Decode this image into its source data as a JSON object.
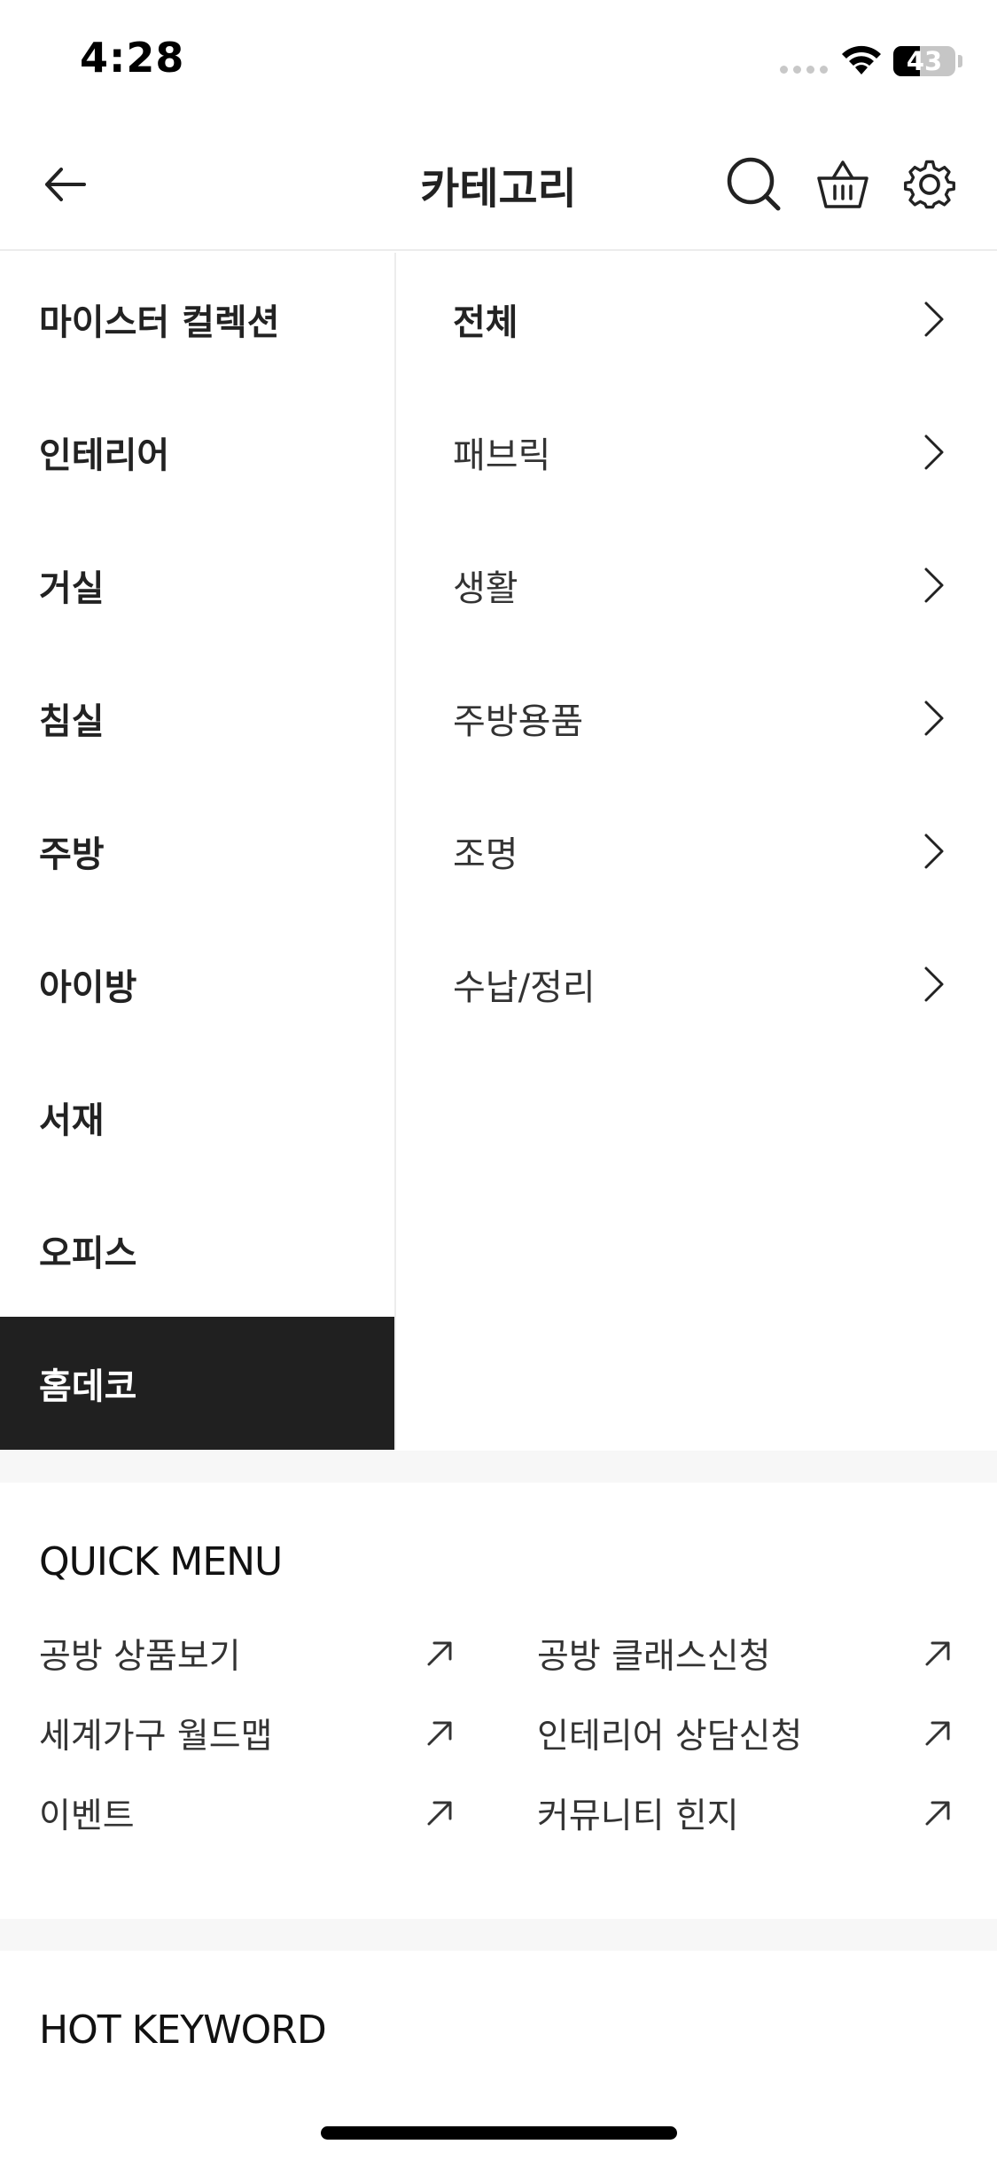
{
  "status": {
    "time": "4:28",
    "battery_level": "43",
    "battery_fraction": 0.43
  },
  "header": {
    "title": "카테고리"
  },
  "categories": {
    "left": [
      {
        "label": "마이스터 컬렉션"
      },
      {
        "label": "인테리어"
      },
      {
        "label": "거실"
      },
      {
        "label": "침실"
      },
      {
        "label": "주방"
      },
      {
        "label": "아이방"
      },
      {
        "label": "서재"
      },
      {
        "label": "오피스"
      },
      {
        "label": "홈데코",
        "selected": true
      }
    ],
    "right": [
      {
        "label": "전체"
      },
      {
        "label": "패브릭"
      },
      {
        "label": "생활"
      },
      {
        "label": "주방용품"
      },
      {
        "label": "조명"
      },
      {
        "label": "수납/정리"
      }
    ]
  },
  "quick_menu": {
    "title": "QUICK MENU",
    "items": [
      {
        "label": "공방 상품보기"
      },
      {
        "label": "공방 클래스신청"
      },
      {
        "label": "세계가구 월드맵"
      },
      {
        "label": "인테리어 상담신청"
      },
      {
        "label": "이벤트"
      },
      {
        "label": "커뮤니티 힌지"
      }
    ]
  },
  "hot_keyword": {
    "title": "HOT KEYWORD"
  },
  "colors": {
    "selected_bg": "#202020",
    "text": "#222222",
    "divider": "#f7f7f7"
  },
  "icons": {
    "back": "arrow-left-icon",
    "search": "search-icon",
    "cart": "basket-icon",
    "settings": "gear-icon",
    "chevron": "chevron-right-icon",
    "external": "arrow-up-right-icon"
  }
}
